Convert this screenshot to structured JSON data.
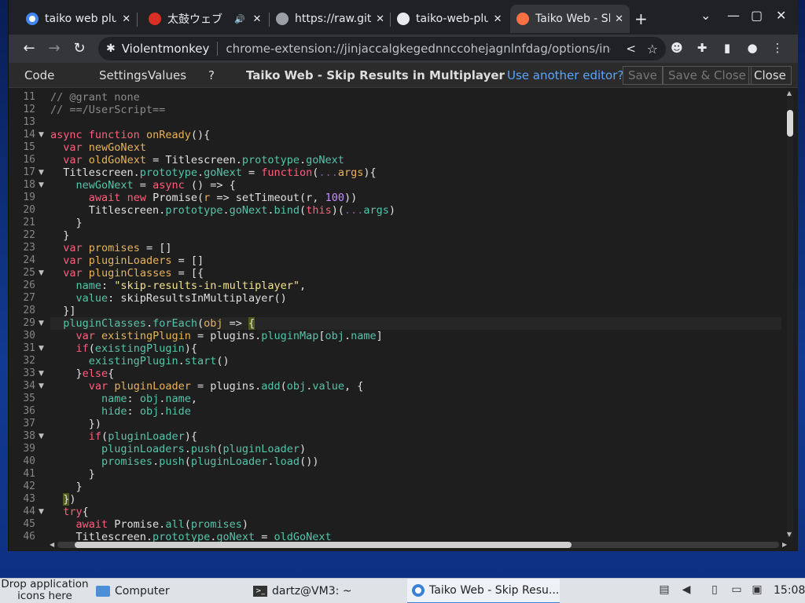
{
  "browser": {
    "tabs": [
      {
        "title": "taiko web plugin",
        "close": "✕",
        "icon_color": "#4285f4"
      },
      {
        "title": "太鼓ウェブ",
        "close": "✕",
        "icon_color": "#d93025",
        "audio": "🔊"
      },
      {
        "title": "https://raw.githubusercontent",
        "close": "✕",
        "icon_color": "#9aa0a6"
      },
      {
        "title": "taiko-web-plugins",
        "close": "✕",
        "icon_color": "#e8eaed"
      },
      {
        "title": "Taiko Web - Skip Results",
        "close": "✕",
        "icon_color": "#ff7043"
      }
    ],
    "new_tab": "+",
    "window_controls": [
      "⌄",
      "—",
      "▢",
      "✕"
    ],
    "nav": {
      "back": "←",
      "forward": "→",
      "reload": "↻"
    },
    "omnibox": {
      "extension_label": "Violentmonkey",
      "url": "chrome-extension://jinjaccalgkegednnccohejagnlnfdag/options/index.html",
      "share_icon": "share-icon",
      "star_icon": "star-icon"
    },
    "toolbar_icons": [
      "violentmonkey-icon",
      "puzzle-icon",
      "sidepanel-icon",
      "profile-icon",
      "menu-icon"
    ]
  },
  "editor": {
    "tabs": [
      "Code",
      "Settings",
      "Values",
      "?"
    ],
    "title": "Taiko Web - Skip Results in Multiplayer",
    "link": "Use another editor?",
    "buttons": {
      "save": "Save",
      "save_close": "Save & Close",
      "close": "Close"
    },
    "lines": [
      {
        "n": "11",
        "fold": false,
        "html": "<span class=\"cm\">// @grant none</span>"
      },
      {
        "n": "12",
        "fold": false,
        "html": "<span class=\"cm\">// ==/UserScript==</span>"
      },
      {
        "n": "13",
        "fold": false,
        "html": ""
      },
      {
        "n": "14",
        "fold": true,
        "html": "<span class=\"kw\">async</span> <span class=\"kw\">function</span> <span class=\"fn\">onReady</span>(){"
      },
      {
        "n": "15",
        "fold": false,
        "html": "  <span class=\"kw\">var</span> <span class=\"fn\">newGoNext</span>"
      },
      {
        "n": "16",
        "fold": false,
        "html": "  <span class=\"kw\">var</span> <span class=\"fn\">oldGoNext</span> = Titlescreen.<span class=\"pr\">prototype</span>.<span class=\"pr\">goNext</span>"
      },
      {
        "n": "17",
        "fold": true,
        "html": "  Titlescreen.<span class=\"pr\">prototype</span>.<span class=\"pr\">goNext</span> = <span class=\"kw\">function</span>(<span class=\"mp\">...</span><span class=\"fn\">args</span>){"
      },
      {
        "n": "18",
        "fold": true,
        "html": "    <span class=\"pr\">newGoNext</span> = <span class=\"kw\">async</span> () => {"
      },
      {
        "n": "19",
        "fold": false,
        "html": "      <span class=\"kw\">await</span> <span class=\"kw\">new</span> Promise(<span class=\"fn\">r</span> => setTimeout(r, <span class=\"nm\">100</span>))"
      },
      {
        "n": "20",
        "fold": false,
        "html": "      Titlescreen.<span class=\"pr\">prototype</span>.<span class=\"pr\">goNext</span>.<span class=\"pr\">bind</span>(<span class=\"kw\">this</span>)(<span class=\"mp\">...</span><span class=\"pr\">args</span>)"
      },
      {
        "n": "21",
        "fold": false,
        "html": "    }"
      },
      {
        "n": "22",
        "fold": false,
        "html": "  }"
      },
      {
        "n": "23",
        "fold": false,
        "html": "  <span class=\"kw\">var</span> <span class=\"fn\">promises</span> = []"
      },
      {
        "n": "24",
        "fold": false,
        "html": "  <span class=\"kw\">var</span> <span class=\"fn\">pluginLoaders</span> = []"
      },
      {
        "n": "25",
        "fold": true,
        "html": "  <span class=\"kw\">var</span> <span class=\"fn\">pluginClasses</span> = [{"
      },
      {
        "n": "26",
        "fold": false,
        "html": "    <span class=\"pr\">name</span>: <span class=\"st\">\"skip-results-in-multiplayer\"</span>,"
      },
      {
        "n": "27",
        "fold": false,
        "html": "    <span class=\"pr\">value</span>: skipResultsInMultiplayer()"
      },
      {
        "n": "28",
        "fold": false,
        "html": "  }]"
      },
      {
        "n": "29",
        "fold": true,
        "cur": true,
        "html": "  <span class=\"pr\">pluginClasses</span>.<span class=\"pr\">forEach</span>(<span class=\"fn\">obj</span> => <span class=\"br\">{</span>"
      },
      {
        "n": "30",
        "fold": false,
        "html": "    <span class=\"kw\">var</span> <span class=\"fn\">existingPlugin</span> = plugins.<span class=\"pr\">pluginMap</span>[<span class=\"pr\">obj</span>.<span class=\"pr\">name</span>]"
      },
      {
        "n": "31",
        "fold": true,
        "html": "    <span class=\"kw\">if</span>(<span class=\"pr\">existingPlugin</span>){"
      },
      {
        "n": "32",
        "fold": false,
        "html": "      <span class=\"pr\">existingPlugin</span>.<span class=\"pr\">start</span>()"
      },
      {
        "n": "33",
        "fold": true,
        "html": "    }<span class=\"kw\">else</span>{"
      },
      {
        "n": "34",
        "fold": true,
        "html": "      <span class=\"kw\">var</span> <span class=\"fn\">pluginLoader</span> = plugins.<span class=\"pr\">add</span>(<span class=\"pr\">obj</span>.<span class=\"pr\">value</span>, {"
      },
      {
        "n": "35",
        "fold": false,
        "html": "        <span class=\"pr\">name</span>: <span class=\"pr\">obj</span>.<span class=\"pr\">name</span>,"
      },
      {
        "n": "36",
        "fold": false,
        "html": "        <span class=\"pr\">hide</span>: <span class=\"pr\">obj</span>.<span class=\"pr\">hide</span>"
      },
      {
        "n": "37",
        "fold": false,
        "html": "      })"
      },
      {
        "n": "38",
        "fold": true,
        "html": "      <span class=\"kw\">if</span>(<span class=\"pr\">pluginLoader</span>){"
      },
      {
        "n": "39",
        "fold": false,
        "html": "        <span class=\"pr\">pluginLoaders</span>.<span class=\"pr\">push</span>(<span class=\"pr\">pluginLoader</span>)"
      },
      {
        "n": "40",
        "fold": false,
        "html": "        <span class=\"pr\">promises</span>.<span class=\"pr\">push</span>(<span class=\"pr\">pluginLoader</span>.<span class=\"pr\">load</span>())"
      },
      {
        "n": "41",
        "fold": false,
        "html": "      }"
      },
      {
        "n": "42",
        "fold": false,
        "html": "    }"
      },
      {
        "n": "43",
        "fold": false,
        "html": "  <span class=\"br\">}</span>)"
      },
      {
        "n": "44",
        "fold": true,
        "html": "  <span class=\"kw\">try</span>{"
      },
      {
        "n": "45",
        "fold": false,
        "html": "    <span class=\"kw\">await</span> Promise.<span class=\"pr\">all</span>(<span class=\"pr\">promises</span>)"
      },
      {
        "n": "46",
        "fold": false,
        "html": "    Titlescreen.<span class=\"pr\">prototype</span>.<span class=\"pr\">goNext</span> = <span class=\"pr\">oldGoNext</span>"
      }
    ]
  },
  "taskbar": {
    "drop_hint": "Drop application icons here",
    "items": [
      {
        "label": "Computer",
        "icon": "folder-icon"
      },
      {
        "label": "dartz@VM3: ~",
        "icon": "terminal-icon"
      },
      {
        "label": "Taiko Web - Skip Resu...",
        "icon": "chrome-icon",
        "active": true
      }
    ],
    "clock": "15:08"
  }
}
